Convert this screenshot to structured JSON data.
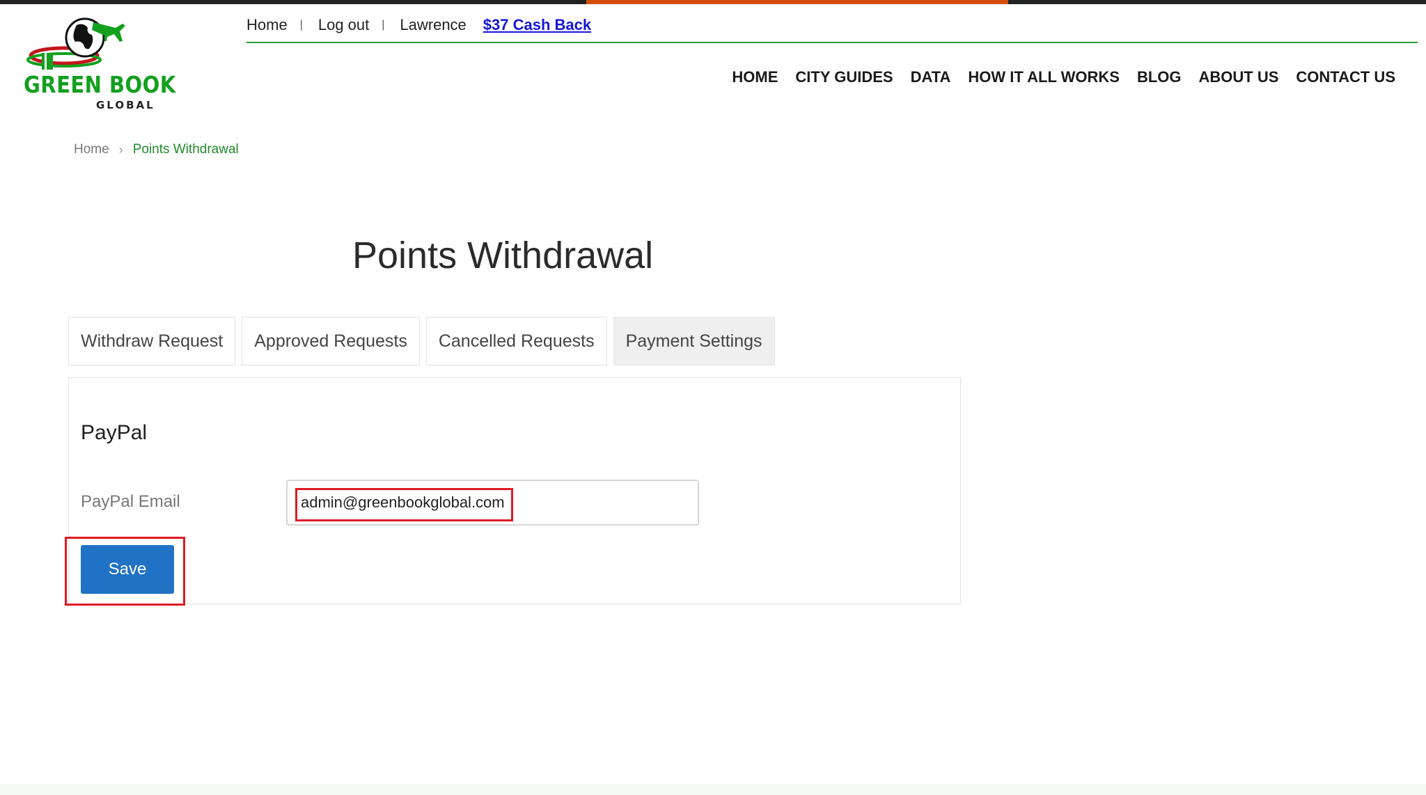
{
  "brand": {
    "name": "GREEN BOOK",
    "sub": "GLOBAL",
    "colors": {
      "green": "#12a01e",
      "accent": "#d24d0a"
    }
  },
  "utility_nav": {
    "home": "Home",
    "separator": "|",
    "logout": "Log out",
    "user": "Lawrence",
    "cashback": "$37 Cash Back"
  },
  "main_nav": {
    "items": [
      "HOME",
      "CITY GUIDES",
      "DATA",
      "HOW IT ALL WORKS",
      "BLOG",
      "ABOUT US",
      "CONTACT US"
    ]
  },
  "breadcrumb": {
    "home": "Home",
    "current": "Points Withdrawal"
  },
  "page": {
    "title": "Points Withdrawal"
  },
  "tabs": [
    {
      "label": "Withdraw Request"
    },
    {
      "label": "Approved Requests"
    },
    {
      "label": "Cancelled Requests"
    },
    {
      "label": "Payment Settings",
      "active": true
    }
  ],
  "paypal": {
    "section_title": "PayPal",
    "email_label": "PayPal Email",
    "email_value": "admin@greenbookglobal.com",
    "save_label": "Save"
  }
}
